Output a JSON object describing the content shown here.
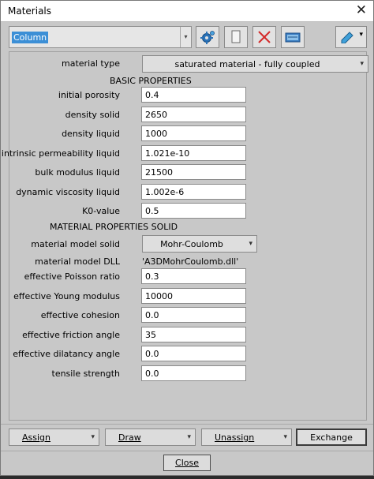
{
  "window": {
    "title": "Materials",
    "close_glyph": "✕"
  },
  "material_selector": {
    "value": "Column",
    "arrow": "▾"
  },
  "toolbar": {
    "icons": [
      "gear-icon",
      "new-document-icon",
      "delete-x-icon",
      "preview-icon",
      "edit-menu-icon"
    ],
    "menu_arrow": "▾"
  },
  "material_type": {
    "label": "material type",
    "value": "saturated material - fully coupled",
    "arrow": "▾"
  },
  "basic": {
    "heading": "BASIC PROPERTIES",
    "fields": [
      {
        "label": "initial porosity",
        "value": "0.4"
      },
      {
        "label": "density solid",
        "value": "2650"
      },
      {
        "label": "density liquid",
        "value": "1000"
      },
      {
        "label": "intrinsic permeability liquid",
        "value": "1.021e-10"
      },
      {
        "label": "bulk modulus liquid",
        "value": "21500"
      },
      {
        "label": "dynamic viscosity liquid",
        "value": "1.002e-6"
      },
      {
        "label": "K0-value",
        "value": "0.5"
      }
    ]
  },
  "solid": {
    "heading": "MATERIAL PROPERTIES SOLID",
    "model_label": "material model solid",
    "model_value": "Mohr-Coulomb",
    "model_arrow": "▾",
    "dll_label": "material model DLL",
    "dll_value": "'A3DMohrCoulomb.dll'",
    "fields": [
      {
        "label": "effective Poisson ratio",
        "value": "0.3"
      },
      {
        "label": "effective Young modulus",
        "value": "10000"
      },
      {
        "label": "effective cohesion",
        "value": "0.0"
      },
      {
        "label": "effective friction angle",
        "value": "35"
      },
      {
        "label": "effective dilatancy angle",
        "value": "0.0"
      },
      {
        "label": "tensile strength",
        "value": "0.0"
      }
    ]
  },
  "actions": {
    "assign": "Assign",
    "draw": "Draw",
    "unassign": "Unassign",
    "exchange": "Exchange",
    "arrow": "▾",
    "close": "Close"
  },
  "colors": {
    "dialog_bg": "#c8c8c8",
    "selection": "#3c8fd6",
    "delete_red": "#d42a2a",
    "gear_blue": "#2a72b8"
  }
}
